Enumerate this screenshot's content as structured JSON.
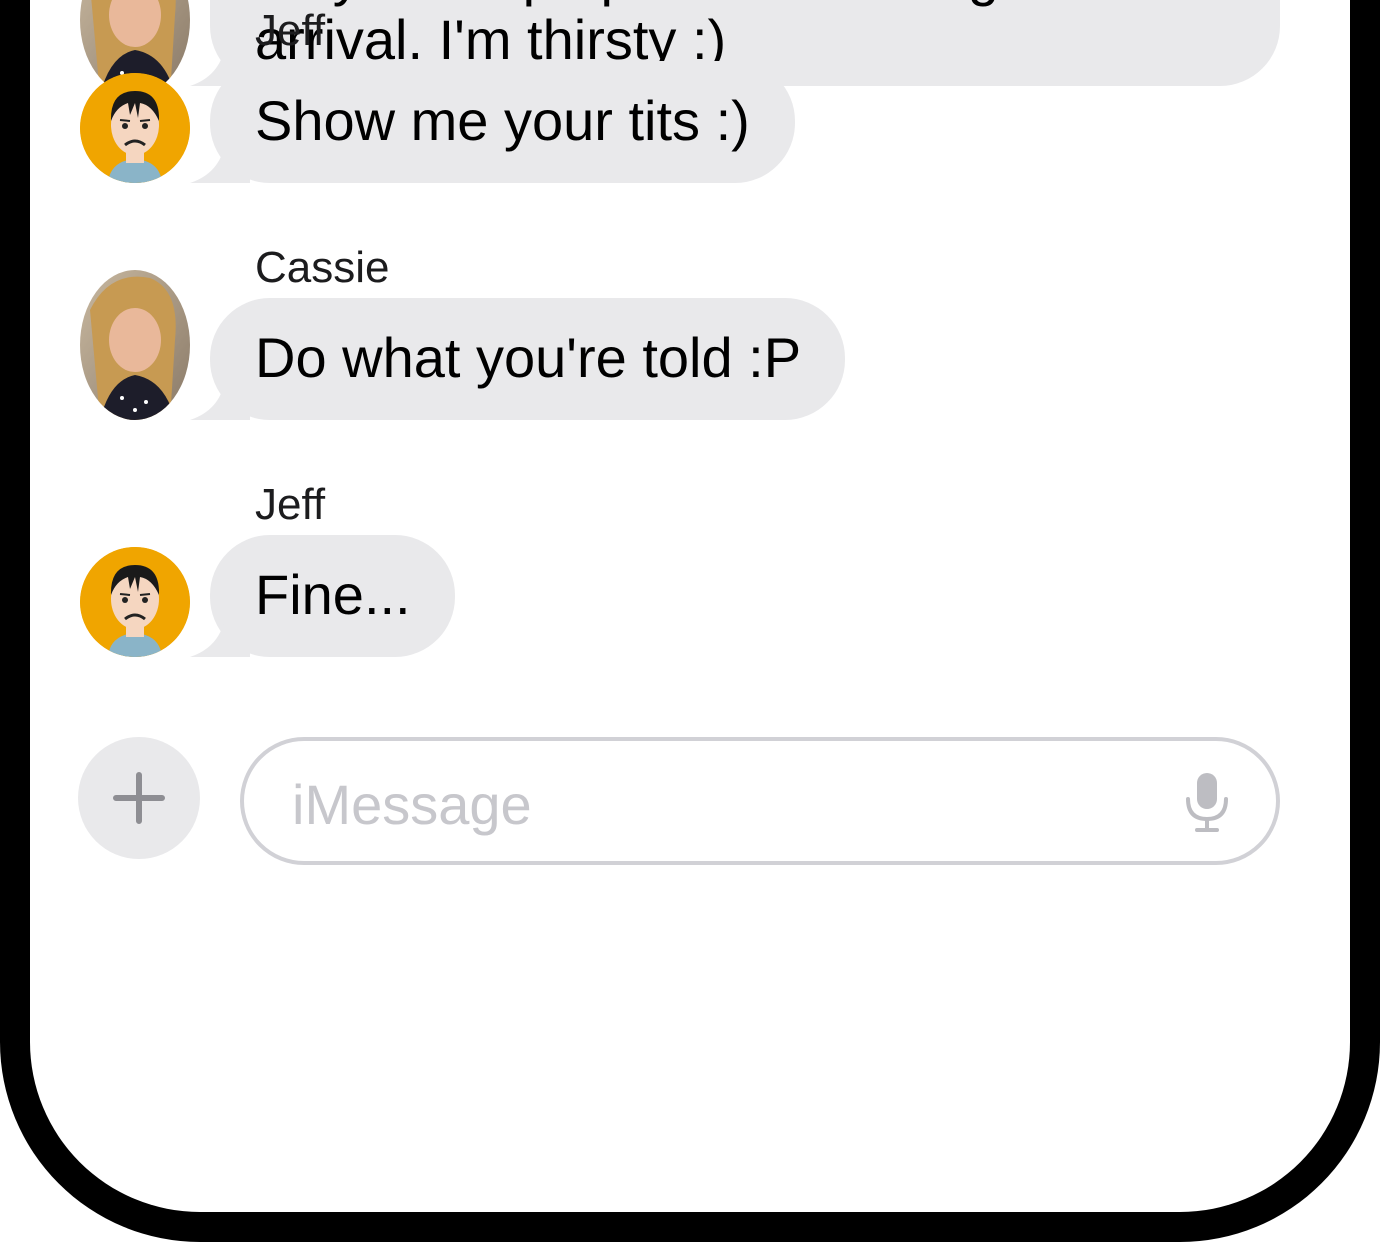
{
  "messages": [
    {
      "sender": "",
      "lines": [
        "Maybe whip up a few beverages for our",
        "arrival.  I'm thirsty :)"
      ],
      "avatar": "cassie-photo-avatar"
    },
    {
      "sender": "Jeff",
      "lines": [
        "Show me your tits :)"
      ],
      "avatar": "jeff-cartoon-avatar"
    },
    {
      "sender": "Cassie",
      "lines": [
        "Do what you're told :P"
      ],
      "avatar": "cassie-photo-avatar"
    },
    {
      "sender": "Jeff",
      "lines": [
        "Fine..."
      ],
      "avatar": "jeff-cartoon-avatar"
    }
  ],
  "composer": {
    "placeholder": "iMessage",
    "add_icon": "plus-icon",
    "mic_icon": "microphone-icon"
  },
  "colors": {
    "bubble": "#e9e9eb",
    "frame": "#000000",
    "jeff_avatar_bg": "#f0a500",
    "placeholder": "#c7c7cc"
  }
}
